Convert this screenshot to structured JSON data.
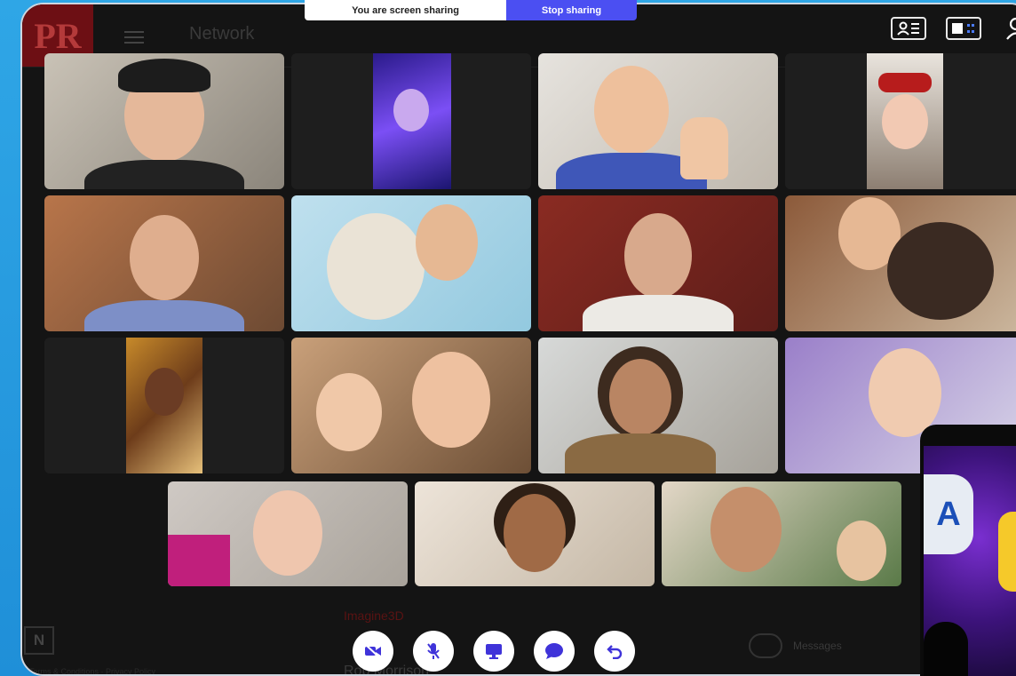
{
  "background_app": {
    "logo_text": "PR",
    "title": "Network",
    "bottom_logo": "N",
    "person_name_1": "Imagine3D",
    "person_name_2": "Rob Morrison",
    "messages_label": "Messages",
    "footer_text": "Terms & Conditions · Privacy Policy"
  },
  "share_banner": {
    "status": "You are screen sharing",
    "stop_label": "Stop sharing"
  },
  "colors": {
    "page_background": "#2fa6e6",
    "stop_sharing": "#4b4ff2",
    "control_button": "#ffffff",
    "control_icon": "#3f33d9"
  },
  "icons": {
    "top_right": [
      "speaker-view-icon",
      "gallery-view-icon",
      "participants-icon"
    ],
    "controls": [
      "video-off-icon",
      "mic-off-icon",
      "share-screen-icon",
      "chat-icon",
      "leave-call-icon"
    ]
  }
}
